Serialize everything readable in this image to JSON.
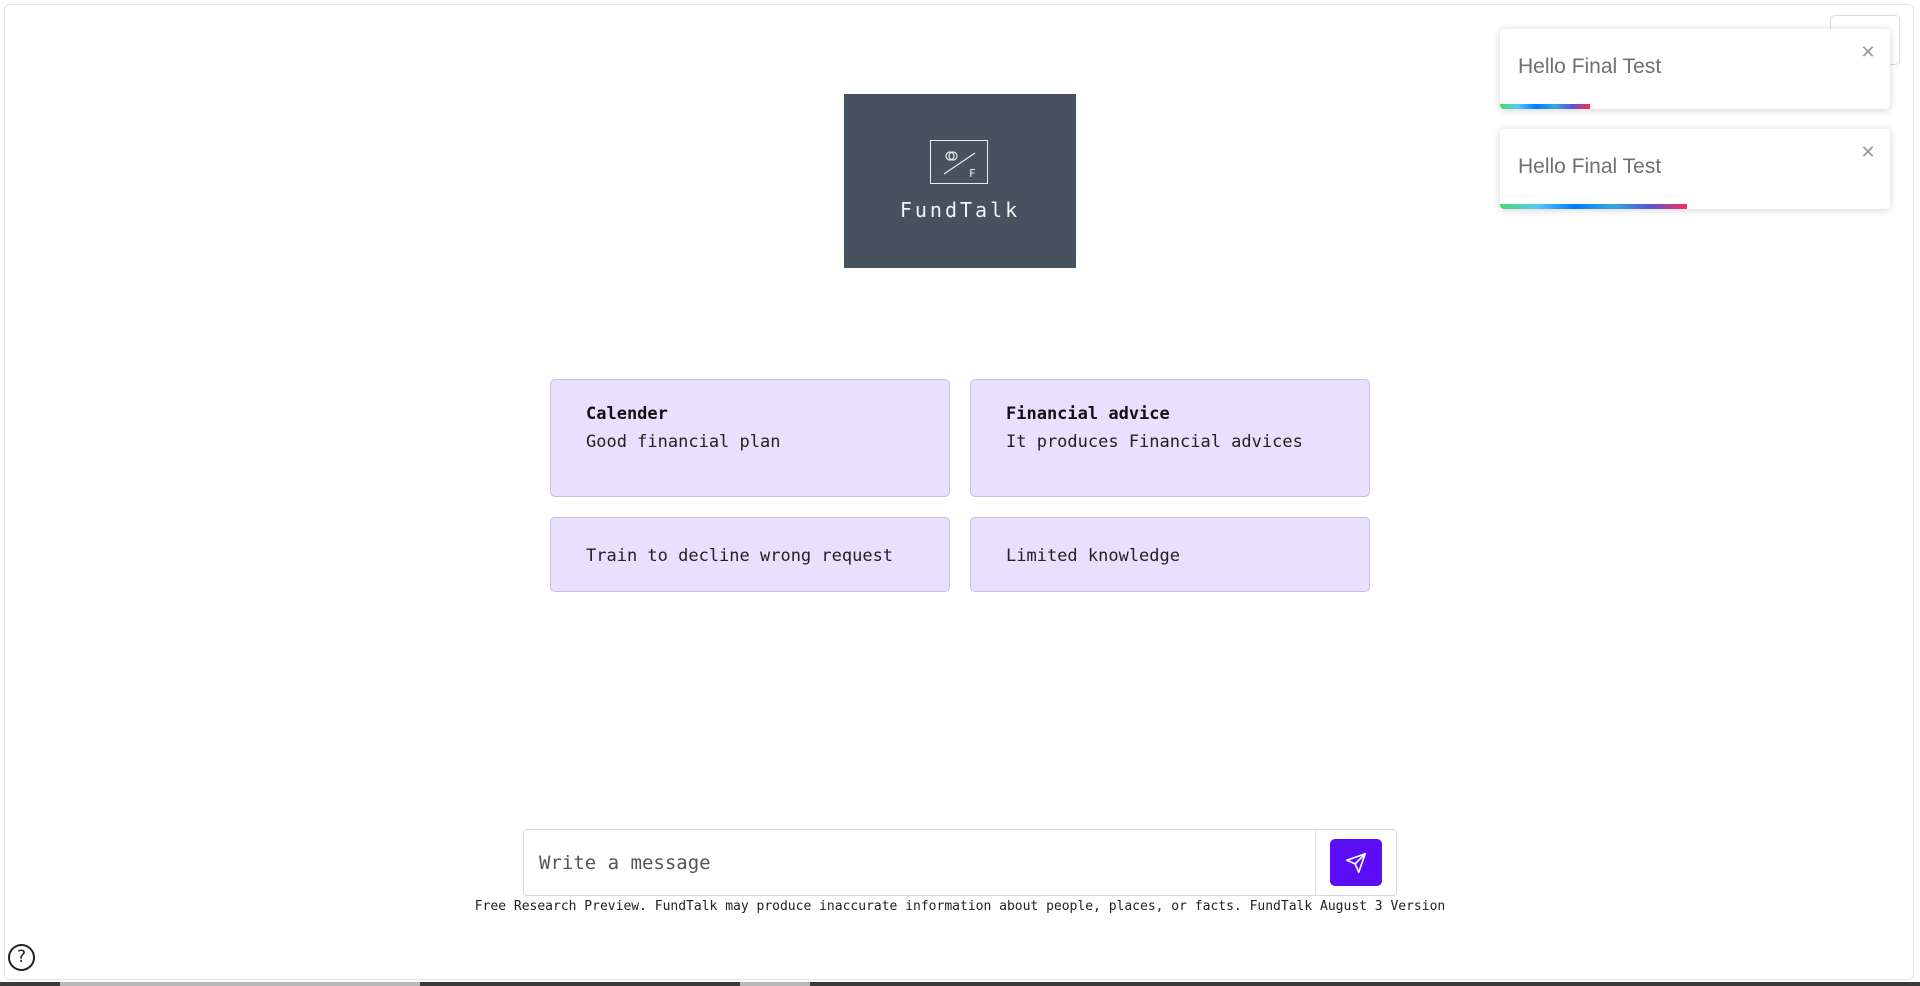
{
  "logo": {
    "name": "FundTalk",
    "emblem_letter": "F"
  },
  "cards": [
    {
      "title": "Calender",
      "subtitle": "Good financial plan"
    },
    {
      "title": "Financial advice",
      "subtitle": "It produces Financial advices"
    },
    {
      "label": "Train to decline wrong request"
    },
    {
      "label": "Limited knowledge"
    }
  ],
  "composer": {
    "placeholder": "Write a message",
    "send_icon": "paper-plane-icon"
  },
  "disclaimer": "Free Research Preview. FundTalk may produce inaccurate information about people, places, or facts. FundTalk August 3 Version",
  "help": {
    "label": "?"
  },
  "menu": {
    "icon": "hamburger-menu-icon"
  },
  "toasts": [
    {
      "message": "Hello Final Test",
      "close": "✕",
      "progress": 0.23
    },
    {
      "message": "Hello Final Test",
      "close": "✕",
      "progress": 0.48
    }
  ],
  "colors": {
    "accent": "#5b0ef5",
    "card_bg": "#e8e0fc",
    "logo_bg": "#47525e"
  }
}
